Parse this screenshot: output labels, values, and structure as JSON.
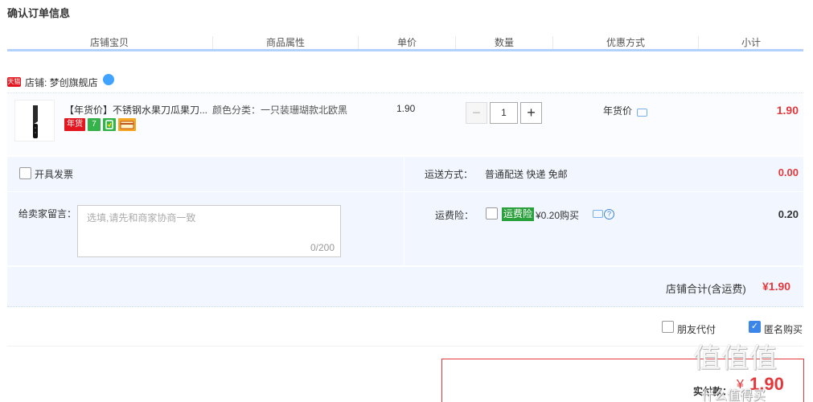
{
  "page_title": "确认订单信息",
  "columns": [
    "店铺宝贝",
    "商品属性",
    "单价",
    "数量",
    "优惠方式",
    "小计"
  ],
  "shop": {
    "badge": "天猫",
    "name": "店铺: 梦创旗舰店"
  },
  "item": {
    "title": "【年货价】不锈钢水果刀瓜果刀...",
    "badges": [
      {
        "text": "年货",
        "color": "#e4161f"
      },
      {
        "text": "7",
        "color": "#35b24a"
      },
      {
        "text": "",
        "color": "#35b24a"
      },
      {
        "text": "",
        "color": "#f5a623"
      }
    ],
    "sku": "颜色分类：一只装珊瑚款北欧黑",
    "price": "1.90",
    "quantity": "1",
    "qty_minus": "−",
    "qty_plus": "+",
    "promo": "年货价",
    "subtotal": "1.90"
  },
  "invoice": {
    "label": "开具发票"
  },
  "shipping": {
    "label": "运送方式：",
    "value": "普通配送 快递 免邮",
    "fee": "0.00"
  },
  "message": {
    "label": "给卖家留言：",
    "placeholder": "选填,请先和商家协商一致",
    "counter": "0/200"
  },
  "insurance": {
    "label": "运费险：",
    "tag": "运费险",
    "price": "¥0.20购买",
    "help": "?",
    "fee": "0.20"
  },
  "shop_total": {
    "label": "店铺合计(含运费)",
    "value": "¥1.90"
  },
  "options": {
    "friend_pay": "朋友代付",
    "anonymous": "匿名购买",
    "anonymous_checked": "✓"
  },
  "payment": {
    "label": "实付款：",
    "symbol": "¥",
    "amount": "1.90"
  },
  "watermark": {
    "logo": "值值值",
    "text": "什么值得买"
  },
  "colors": {
    "accent_red": "#e4393c",
    "accent_blue": "#b2d1ff",
    "panel_bg": "#f2f7ff"
  }
}
